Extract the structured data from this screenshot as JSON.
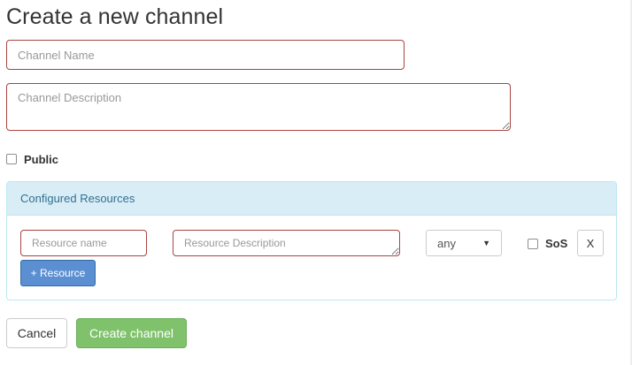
{
  "page": {
    "title": "Create a new channel"
  },
  "form": {
    "channel_name": {
      "value": "",
      "placeholder": "Channel Name"
    },
    "channel_description": {
      "value": "",
      "placeholder": "Channel Description"
    },
    "public_label": "Public",
    "public_checked": false
  },
  "resources_panel": {
    "heading": "Configured Resources",
    "rows": [
      {
        "name": {
          "value": "",
          "placeholder": "Resource name"
        },
        "description": {
          "value": "",
          "placeholder": "Resource Description"
        },
        "type_selected": "any",
        "sos_label": "SoS",
        "sos_checked": false,
        "remove_label": "X"
      }
    ],
    "add_button_label": "+ Resource"
  },
  "actions": {
    "cancel_label": "Cancel",
    "create_label": "Create channel"
  },
  "colors": {
    "error_border": "#a94442",
    "panel_heading_bg": "#d9edf7",
    "panel_heading_text": "#31708f",
    "primary": "#5b8fd1",
    "success": "#7fc26b"
  }
}
